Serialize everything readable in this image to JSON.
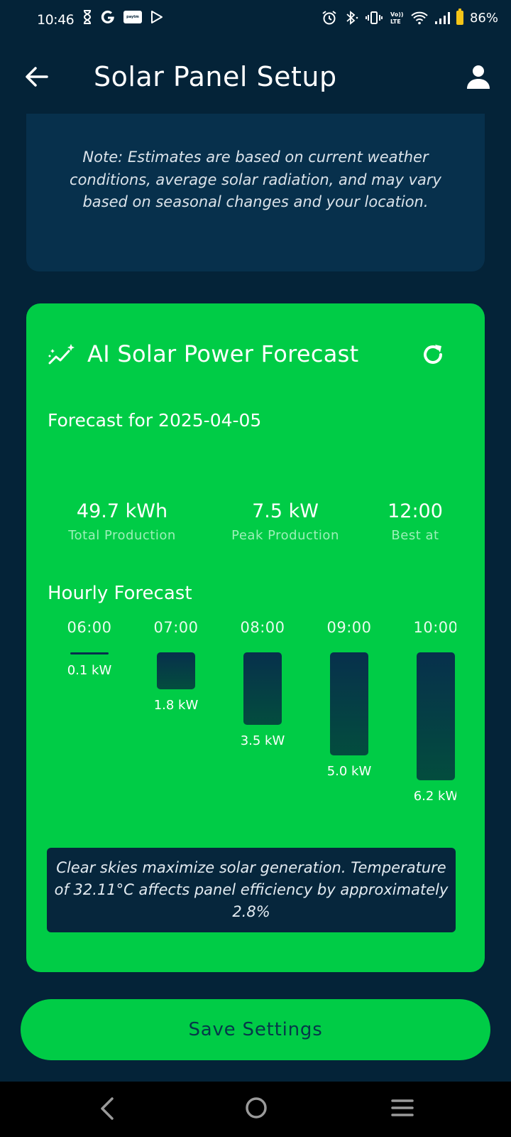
{
  "status_bar": {
    "time": "10:46",
    "battery_percent": "86%",
    "left_icons": [
      "hourglass-icon",
      "google-icon",
      "paytm-icon",
      "play-icon"
    ],
    "right_icons": [
      "alarm-icon",
      "bluetooth-icon",
      "vibrate-icon",
      "volte-icon",
      "wifi-icon",
      "signal-icon",
      "battery-icon"
    ],
    "paytm_label": "paytm"
  },
  "app_bar": {
    "title": "Solar Panel Setup"
  },
  "note": {
    "text": "Note: Estimates are based on current weather conditions, average solar radiation, and may vary based on seasonal changes and your location."
  },
  "forecast": {
    "title": "AI Solar Power Forecast",
    "date_line": "Forecast for 2025-04-05",
    "stats": [
      {
        "value": "49.7 kWh",
        "label": "Total Production"
      },
      {
        "value": "7.5 kW",
        "label": "Peak Production"
      },
      {
        "value": "12:00",
        "label": "Best at"
      }
    ],
    "hourly_title": "Hourly Forecast",
    "hourly": [
      {
        "time": "06:00",
        "value": "0.1 kW",
        "kw": 0.1
      },
      {
        "time": "07:00",
        "value": "1.8 kW",
        "kw": 1.8
      },
      {
        "time": "08:00",
        "value": "3.5 kW",
        "kw": 3.5
      },
      {
        "time": "09:00",
        "value": "5.0 kW",
        "kw": 5.0
      },
      {
        "time": "10:00",
        "value": "6.2 kW",
        "kw": 6.2
      }
    ],
    "insight": "Clear skies maximize solar generation. Temperature of 32.11°C affects panel efficiency by approximately 2.8%"
  },
  "save_button": {
    "label": "Save Settings"
  },
  "colors": {
    "background": "#042338",
    "card_green": "#00cc46",
    "note_card": "#07304c"
  }
}
